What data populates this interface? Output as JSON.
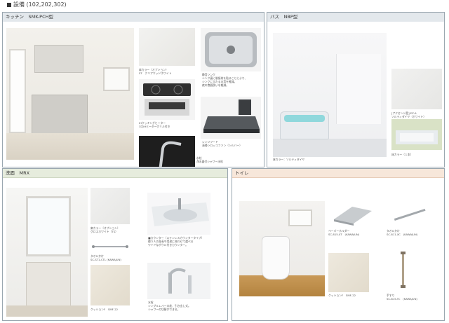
{
  "header": {
    "title": "設備 (102,202,302)"
  },
  "kitchen": {
    "title": "キッチン　SMK-PCH型",
    "captions": {
      "color": "扉カラー（オプション）\nST　クリアウッドホワイト",
      "sink": "静音シンク\nシンク裏に制振材を貼ることにより、\nシンクに当たる水音を軽減。\n夜の食器洗いを軽減。",
      "range": "IHクッキングヒーター\n3口IHヒーターグリル付き",
      "hood": "レンジフード\n清掃シロッコファン（シルバー）",
      "faucet": "水栓\n浄水器付シャワー水栓"
    }
  },
  "bath": {
    "title": "バス　NBP型",
    "captions": {
      "wall": "[アクセント壁] EZ-A\nソルティダイヤ（ホワイト）",
      "floor": "床カラー（１本）",
      "main": "床カラー：ソルティダイヤ"
    }
  },
  "wash": {
    "title": "洗面　MRX",
    "captions": {
      "door": "扉カラー（オプション）\nグロスホワイト（TS）",
      "counter": "■カウンター（ステンレスカウンタータイプ）\n使う人の身長や用途に合わせて選べる\nワイドなボウル付きカウンター。",
      "bar": "タオルかけ\nSC-ST1-CTL (KAWAJUN)",
      "cushion": "クッションF　SMF-22",
      "faucet": "水栓\nシングルレバー水栓、引き出し式。\nシャワーの切替ができる。"
    }
  },
  "toilet": {
    "title": "トイレ",
    "captions": {
      "paper": "ペーパーホルダー\nSC-815-XT　(KAWAJUN)",
      "towel": "タオルかけ\nSC-811-XC　(KAWAJUN)",
      "floor": "クッションF　SMF-22",
      "grab": "手すり\nSC-815-TC　(KAWAJUN)"
    }
  }
}
